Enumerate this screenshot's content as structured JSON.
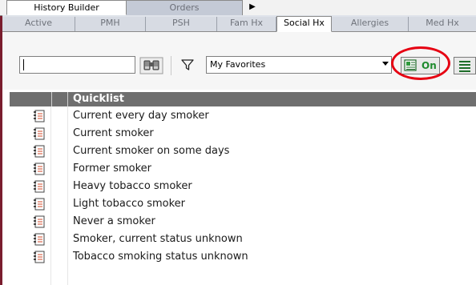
{
  "top_tabs": {
    "active": "History Builder",
    "inactive": "Orders",
    "more_glyph": "▶"
  },
  "sub_tabs": [
    "Active",
    "PMH",
    "PSH",
    "Fam Hx",
    "Social Hx",
    "Allergies",
    "Med Hx"
  ],
  "active_sub_tab": "Social Hx",
  "toolbar": {
    "search_value": "",
    "search_icon": "binoculars-icon",
    "filter_icon": "filter-icon",
    "favorites_value": "My Favorites",
    "on_label": "On",
    "list_icon": "list-icon"
  },
  "colors": {
    "on_green": "#1f8a2e",
    "ring_red": "#e60012",
    "header_gray": "#6f6f6f"
  },
  "grid": {
    "header": "Quicklist",
    "rows": [
      "Current every day smoker",
      "Current smoker",
      "Current smoker on some days",
      "Former smoker",
      "Heavy tobacco smoker",
      "Light tobacco smoker",
      "Never a smoker",
      "Smoker, current status unknown",
      "Tobacco smoking status unknown"
    ]
  }
}
